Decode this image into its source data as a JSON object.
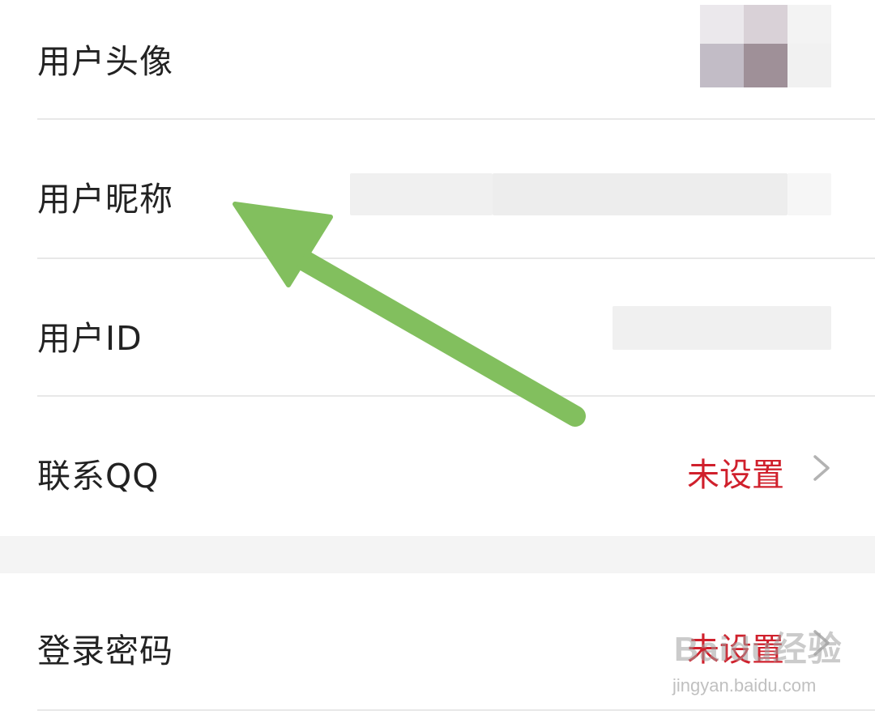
{
  "settings": {
    "rows": [
      {
        "label": "用户头像"
      },
      {
        "label": "用户昵称"
      },
      {
        "label": "用户ID"
      },
      {
        "label": "联系QQ",
        "value": "未设置"
      },
      {
        "label": "登录密码",
        "value": "未设置"
      }
    ]
  },
  "colors": {
    "value_red": "#d0202c",
    "chevron_gray": "#b3b3b3",
    "arrow_green": "#82bf5e",
    "label_text": "#222222"
  },
  "icons": {
    "chevron": "chevron-right-icon",
    "arrow": "arrow-annotation-icon"
  },
  "watermark": {
    "logo": "Baidu经验",
    "url": "jingyan.baidu.com"
  }
}
